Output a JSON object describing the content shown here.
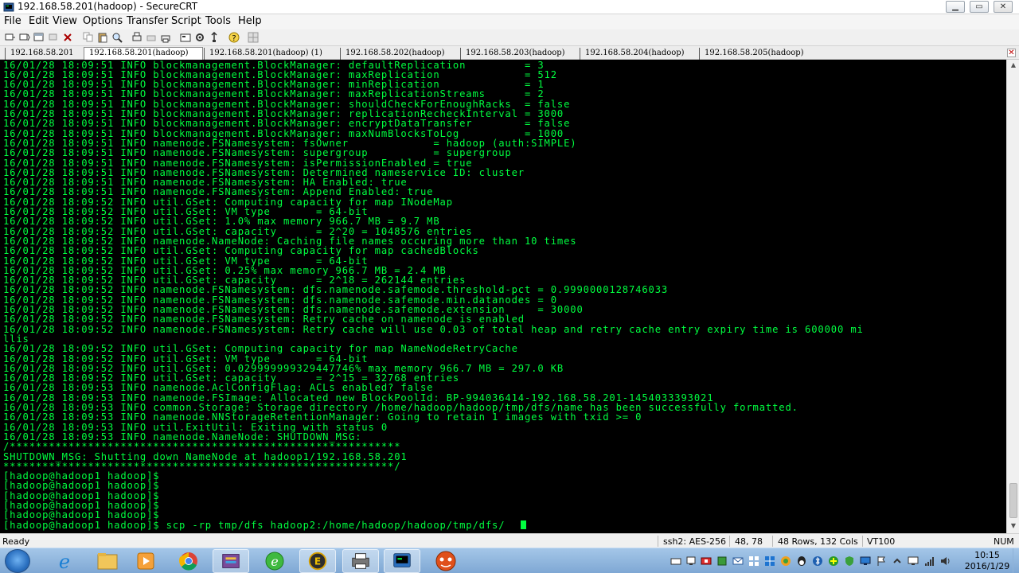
{
  "window": {
    "title": "192.168.58.201(hadoop) - SecureCRT"
  },
  "menu": [
    "File",
    "Edit",
    "View",
    "Options",
    "Transfer",
    "Script",
    "Tools",
    "Help"
  ],
  "toolbar": {
    "icons": [
      "connect-icon",
      "quick-connect-icon",
      "connect-tab-icon",
      "reconnect-icon",
      "disconnect-icon",
      "copy-icon",
      "paste-icon",
      "find-icon",
      "print-setup-icon",
      "print-icon",
      "print-selection-icon",
      "session-options-icon",
      "global-options-icon",
      "keymap-icon",
      "help-icon",
      "tile-icon"
    ]
  },
  "tabs": [
    {
      "label": "192.168.58.201"
    },
    {
      "label": "192.168.58.201(hadoop)",
      "active": true
    },
    {
      "label": "192.168.58.201(hadoop) (1)"
    },
    {
      "label": "192.168.58.202(hadoop)"
    },
    {
      "label": "192.168.58.203(hadoop)"
    },
    {
      "label": "192.168.58.204(hadoop)"
    },
    {
      "label": "192.168.58.205(hadoop)"
    }
  ],
  "terminal": {
    "lines": [
      "16/01/28 18:09:51 INFO blockmanagement.BlockManager: defaultReplication         = 3",
      "16/01/28 18:09:51 INFO blockmanagement.BlockManager: maxReplication             = 512",
      "16/01/28 18:09:51 INFO blockmanagement.BlockManager: minReplication             = 1",
      "16/01/28 18:09:51 INFO blockmanagement.BlockManager: maxReplicationStreams      = 2",
      "16/01/28 18:09:51 INFO blockmanagement.BlockManager: shouldCheckForEnoughRacks  = false",
      "16/01/28 18:09:51 INFO blockmanagement.BlockManager: replicationRecheckInterval = 3000",
      "16/01/28 18:09:51 INFO blockmanagement.BlockManager: encryptDataTransfer        = false",
      "16/01/28 18:09:51 INFO blockmanagement.BlockManager: maxNumBlocksToLog          = 1000",
      "16/01/28 18:09:51 INFO namenode.FSNamesystem: fsOwner             = hadoop (auth:SIMPLE)",
      "16/01/28 18:09:51 INFO namenode.FSNamesystem: supergroup          = supergroup",
      "16/01/28 18:09:51 INFO namenode.FSNamesystem: isPermissionEnabled = true",
      "16/01/28 18:09:51 INFO namenode.FSNamesystem: Determined nameservice ID: cluster",
      "16/01/28 18:09:51 INFO namenode.FSNamesystem: HA Enabled: true",
      "16/01/28 18:09:51 INFO namenode.FSNamesystem: Append Enabled: true",
      "16/01/28 18:09:52 INFO util.GSet: Computing capacity for map INodeMap",
      "16/01/28 18:09:52 INFO util.GSet: VM type       = 64-bit",
      "16/01/28 18:09:52 INFO util.GSet: 1.0% max memory 966.7 MB = 9.7 MB",
      "16/01/28 18:09:52 INFO util.GSet: capacity      = 2^20 = 1048576 entries",
      "16/01/28 18:09:52 INFO namenode.NameNode: Caching file names occuring more than 10 times",
      "16/01/28 18:09:52 INFO util.GSet: Computing capacity for map cachedBlocks",
      "16/01/28 18:09:52 INFO util.GSet: VM type       = 64-bit",
      "16/01/28 18:09:52 INFO util.GSet: 0.25% max memory 966.7 MB = 2.4 MB",
      "16/01/28 18:09:52 INFO util.GSet: capacity      = 2^18 = 262144 entries",
      "16/01/28 18:09:52 INFO namenode.FSNamesystem: dfs.namenode.safemode.threshold-pct = 0.9990000128746033",
      "16/01/28 18:09:52 INFO namenode.FSNamesystem: dfs.namenode.safemode.min.datanodes = 0",
      "16/01/28 18:09:52 INFO namenode.FSNamesystem: dfs.namenode.safemode.extension     = 30000",
      "16/01/28 18:09:52 INFO namenode.FSNamesystem: Retry cache on namenode is enabled",
      "16/01/28 18:09:52 INFO namenode.FSNamesystem: Retry cache will use 0.03 of total heap and retry cache entry expiry time is 600000 mi",
      "llis",
      "16/01/28 18:09:52 INFO util.GSet: Computing capacity for map NameNodeRetryCache",
      "16/01/28 18:09:52 INFO util.GSet: VM type       = 64-bit",
      "16/01/28 18:09:52 INFO util.GSet: 0.029999999329447746% max memory 966.7 MB = 297.0 KB",
      "16/01/28 18:09:52 INFO util.GSet: capacity      = 2^15 = 32768 entries",
      "16/01/28 18:09:53 INFO namenode.AclConfigFlag: ACLs enabled? false",
      "16/01/28 18:09:53 INFO namenode.FSImage: Allocated new BlockPoolId: BP-994036414-192.168.58.201-1454033393021",
      "16/01/28 18:09:53 INFO common.Storage: Storage directory /home/hadoop/hadoop/tmp/dfs/name has been successfully formatted.",
      "16/01/28 18:09:53 INFO namenode.NNStorageRetentionManager: Going to retain 1 images with txid >= 0",
      "16/01/28 18:09:53 INFO util.ExitUtil: Exiting with status 0",
      "16/01/28 18:09:53 INFO namenode.NameNode: SHUTDOWN_MSG:",
      "/************************************************************",
      "SHUTDOWN_MSG: Shutting down NameNode at hadoop1/192.168.58.201",
      "************************************************************/",
      "[hadoop@hadoop1 hadoop]$",
      "[hadoop@hadoop1 hadoop]$",
      "[hadoop@hadoop1 hadoop]$",
      "[hadoop@hadoop1 hadoop]$",
      "[hadoop@hadoop1 hadoop]$",
      "[hadoop@hadoop1 hadoop]$ scp -rp tmp/dfs hadoop2:/home/hadoop/hadoop/tmp/dfs/"
    ]
  },
  "status": {
    "ready": "Ready",
    "cipher": "ssh2: AES-256",
    "cursor": "48, 78",
    "size": "48 Rows, 132 Cols",
    "emulation": "VT100",
    "num": "NUM"
  },
  "taskbar": {
    "apps": [
      "internet-explorer-icon",
      "file-explorer-icon",
      "media-player-icon",
      "chrome-icon",
      "archive-icon",
      "360-browser-icon",
      "editor-icon",
      "printer-app-icon",
      "securecrt-icon",
      "game-icon"
    ],
    "clock_time": "10:15",
    "clock_date": "2016/1/29"
  },
  "colors": {
    "terminal_bg": "#000000",
    "terminal_fg": "#00ff40"
  }
}
